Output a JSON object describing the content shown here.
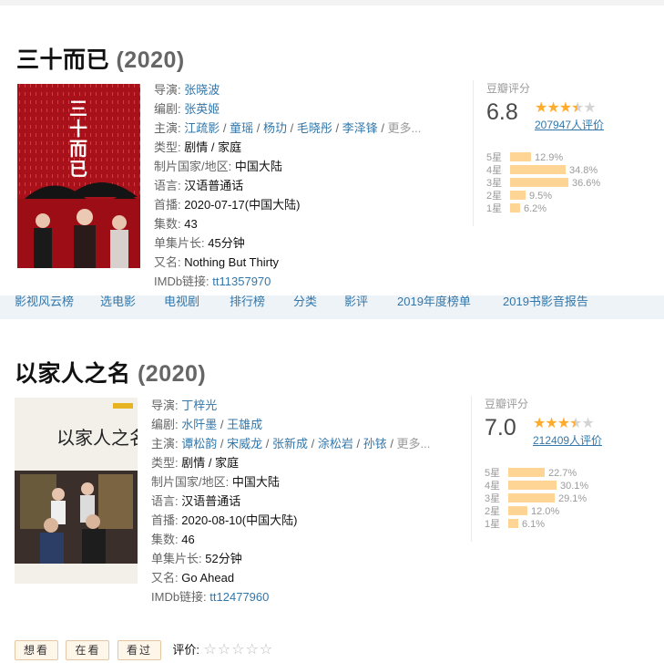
{
  "shows": [
    {
      "title": "三十而已",
      "year": "(2020)",
      "poster_text": "三十而已",
      "director_label": "导演:",
      "director": "张晓波",
      "writer_label": "编剧:",
      "writers": [
        "张英姬"
      ],
      "cast_label": "主演:",
      "cast": [
        "江疏影",
        "童瑶",
        "杨玏",
        "毛晓彤",
        "李泽锋"
      ],
      "more": "更多...",
      "genre_label": "类型:",
      "genre": "剧情 / 家庭",
      "country_label": "制片国家/地区:",
      "country": "中国大陆",
      "language_label": "语言:",
      "language": "汉语普通话",
      "premiere_label": "首播:",
      "premiere": "2020-07-17(中国大陆)",
      "episodes_label": "集数:",
      "episodes": "43",
      "runtime_label": "单集片长:",
      "runtime": "45分钟",
      "aka_label": "又名:",
      "aka": "Nothing But Thirty",
      "imdb_label": "IMDb链接:",
      "imdb": "tt11357970",
      "rating_label": "豆瓣评分",
      "score": "6.8",
      "star_fill": 0.68,
      "votes": "207947人评价",
      "distribution": [
        {
          "label": "5星",
          "pct": "12.9%",
          "value": 12.9
        },
        {
          "label": "4星",
          "pct": "34.8%",
          "value": 34.8
        },
        {
          "label": "3星",
          "pct": "36.6%",
          "value": 36.6
        },
        {
          "label": "2星",
          "pct": "9.5%",
          "value": 9.5
        },
        {
          "label": "1星",
          "pct": "6.2%",
          "value": 6.2
        }
      ]
    },
    {
      "title": "以家人之名",
      "year": "(2020)",
      "poster_text": "以家人之名",
      "director_label": "导演:",
      "director": "丁梓光",
      "writer_label": "编剧:",
      "writers": [
        "水阡墨",
        "王雄成"
      ],
      "cast_label": "主演:",
      "cast": [
        "谭松韵",
        "宋威龙",
        "张新成",
        "涂松岩",
        "孙铱"
      ],
      "more": "更多...",
      "genre_label": "类型:",
      "genre": "剧情 / 家庭",
      "country_label": "制片国家/地区:",
      "country": "中国大陆",
      "language_label": "语言:",
      "language": "汉语普通话",
      "premiere_label": "首播:",
      "premiere": "2020-08-10(中国大陆)",
      "episodes_label": "集数:",
      "episodes": "46",
      "runtime_label": "单集片长:",
      "runtime": "52分钟",
      "aka_label": "又名:",
      "aka": "Go Ahead",
      "imdb_label": "IMDb链接:",
      "imdb": "tt12477960",
      "rating_label": "豆瓣评分",
      "score": "7.0",
      "star_fill": 0.7,
      "votes": "212409人评价",
      "distribution": [
        {
          "label": "5星",
          "pct": "22.7%",
          "value": 22.7
        },
        {
          "label": "4星",
          "pct": "30.1%",
          "value": 30.1
        },
        {
          "label": "3星",
          "pct": "29.1%",
          "value": 29.1
        },
        {
          "label": "2星",
          "pct": "12.0%",
          "value": 12.0
        },
        {
          "label": "1星",
          "pct": "6.1%",
          "value": 6.1
        }
      ]
    }
  ],
  "nav": [
    "影视风云榜",
    "选电影",
    "电视剧",
    "排行榜",
    "分类",
    "影评",
    "2019年度榜单",
    "2019书影音报告"
  ],
  "actions": {
    "want": "想看",
    "watching": "在看",
    "watched": "看过",
    "rate_label": "评价:",
    "rate_stars": "☆☆☆☆☆"
  },
  "colors": {
    "link": "#3377aa",
    "star": "#ffac2d",
    "bar": "#ffd596",
    "nav_bg": "#eef3f7"
  }
}
